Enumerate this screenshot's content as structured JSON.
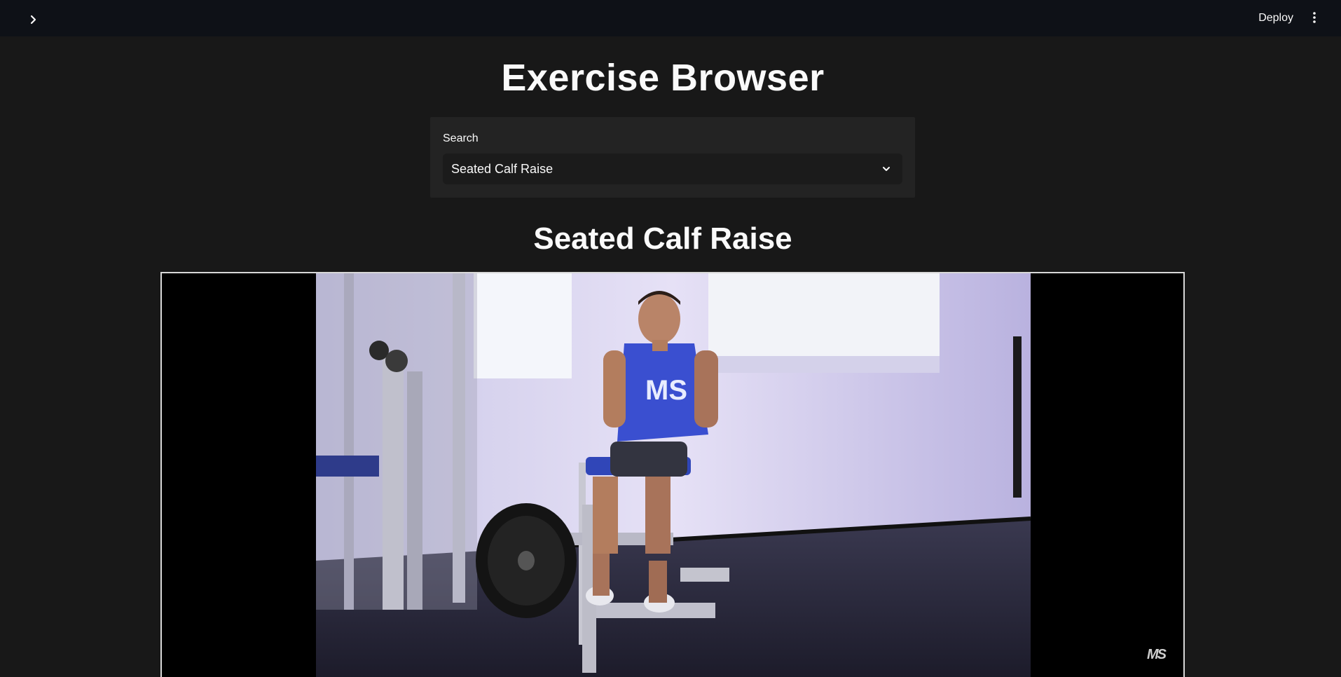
{
  "header": {
    "deploy_label": "Deploy",
    "sidebar_toggle_icon": "chevron-right-icon",
    "menu_icon": "vertical-ellipsis-icon"
  },
  "page": {
    "title": "Exercise Browser"
  },
  "search": {
    "label": "Search",
    "selected_value": "Seated Calf Raise"
  },
  "exercise": {
    "title": "Seated Calf Raise",
    "video": {
      "watermark": "MS"
    }
  },
  "colors": {
    "header_bg": "#0e1117",
    "page_bg": "#181818",
    "panel_bg": "#232323",
    "select_bg": "#1b1b1b",
    "text": "#fafafa",
    "tank_top": "#3a4fd0"
  }
}
